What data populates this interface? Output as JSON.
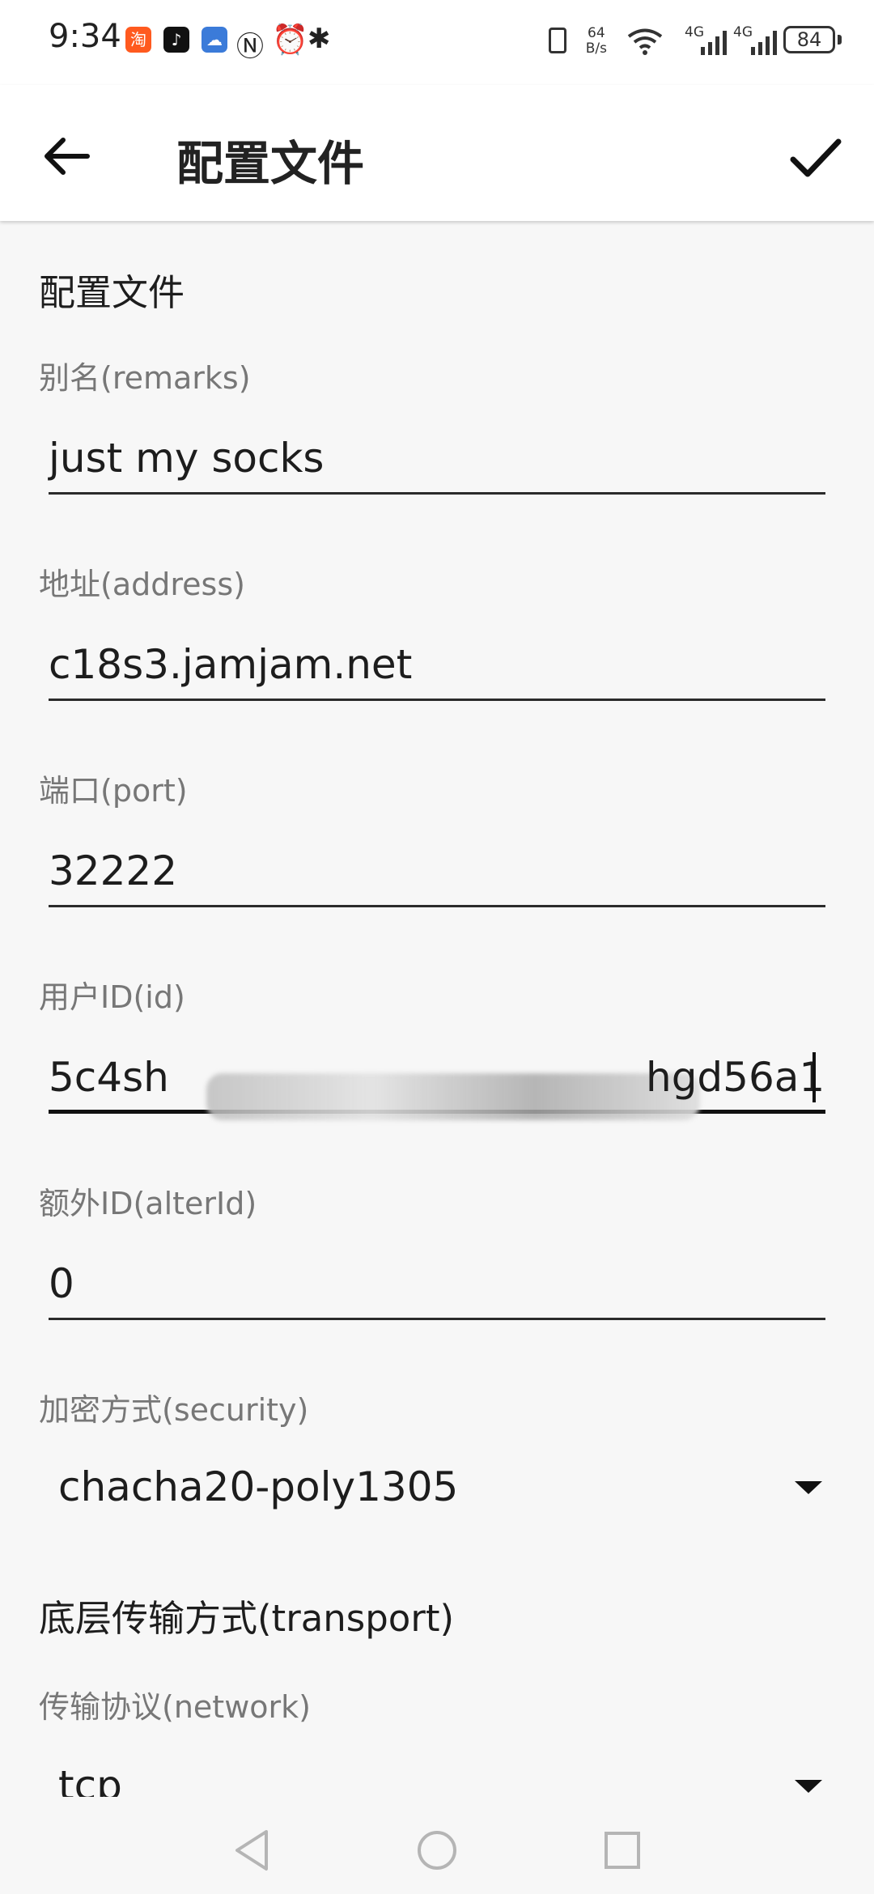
{
  "status_bar": {
    "time": "9:34",
    "speed_top": "64",
    "speed_unit": "B/s",
    "sim1": "4G",
    "sim2": "4G",
    "battery": "84"
  },
  "app_bar": {
    "title": "配置文件"
  },
  "form": {
    "section_profile": "配置文件",
    "remarks": {
      "label": "别名(remarks)",
      "value": "just my socks"
    },
    "address": {
      "label": "地址(address)",
      "value": "c18s3.jamjam.net"
    },
    "port": {
      "label": "端口(port)",
      "value": "32222"
    },
    "id": {
      "label": "用户ID(id)",
      "value_start": "5c4sh",
      "value_end": "hgd56a1"
    },
    "alter_id": {
      "label": "额外ID(alterId)",
      "value": "0"
    },
    "security": {
      "label": "加密方式(security)",
      "value": "chacha20-poly1305"
    },
    "section_transport": "底层传输方式(transport)",
    "network": {
      "label": "传输协议(network)",
      "value": "tcp"
    }
  },
  "icons": {
    "back": "arrow-back-icon",
    "done": "check-icon",
    "nav_back": "triangle-back-icon",
    "nav_home": "circle-home-icon",
    "nav_recents": "square-recents-icon"
  }
}
